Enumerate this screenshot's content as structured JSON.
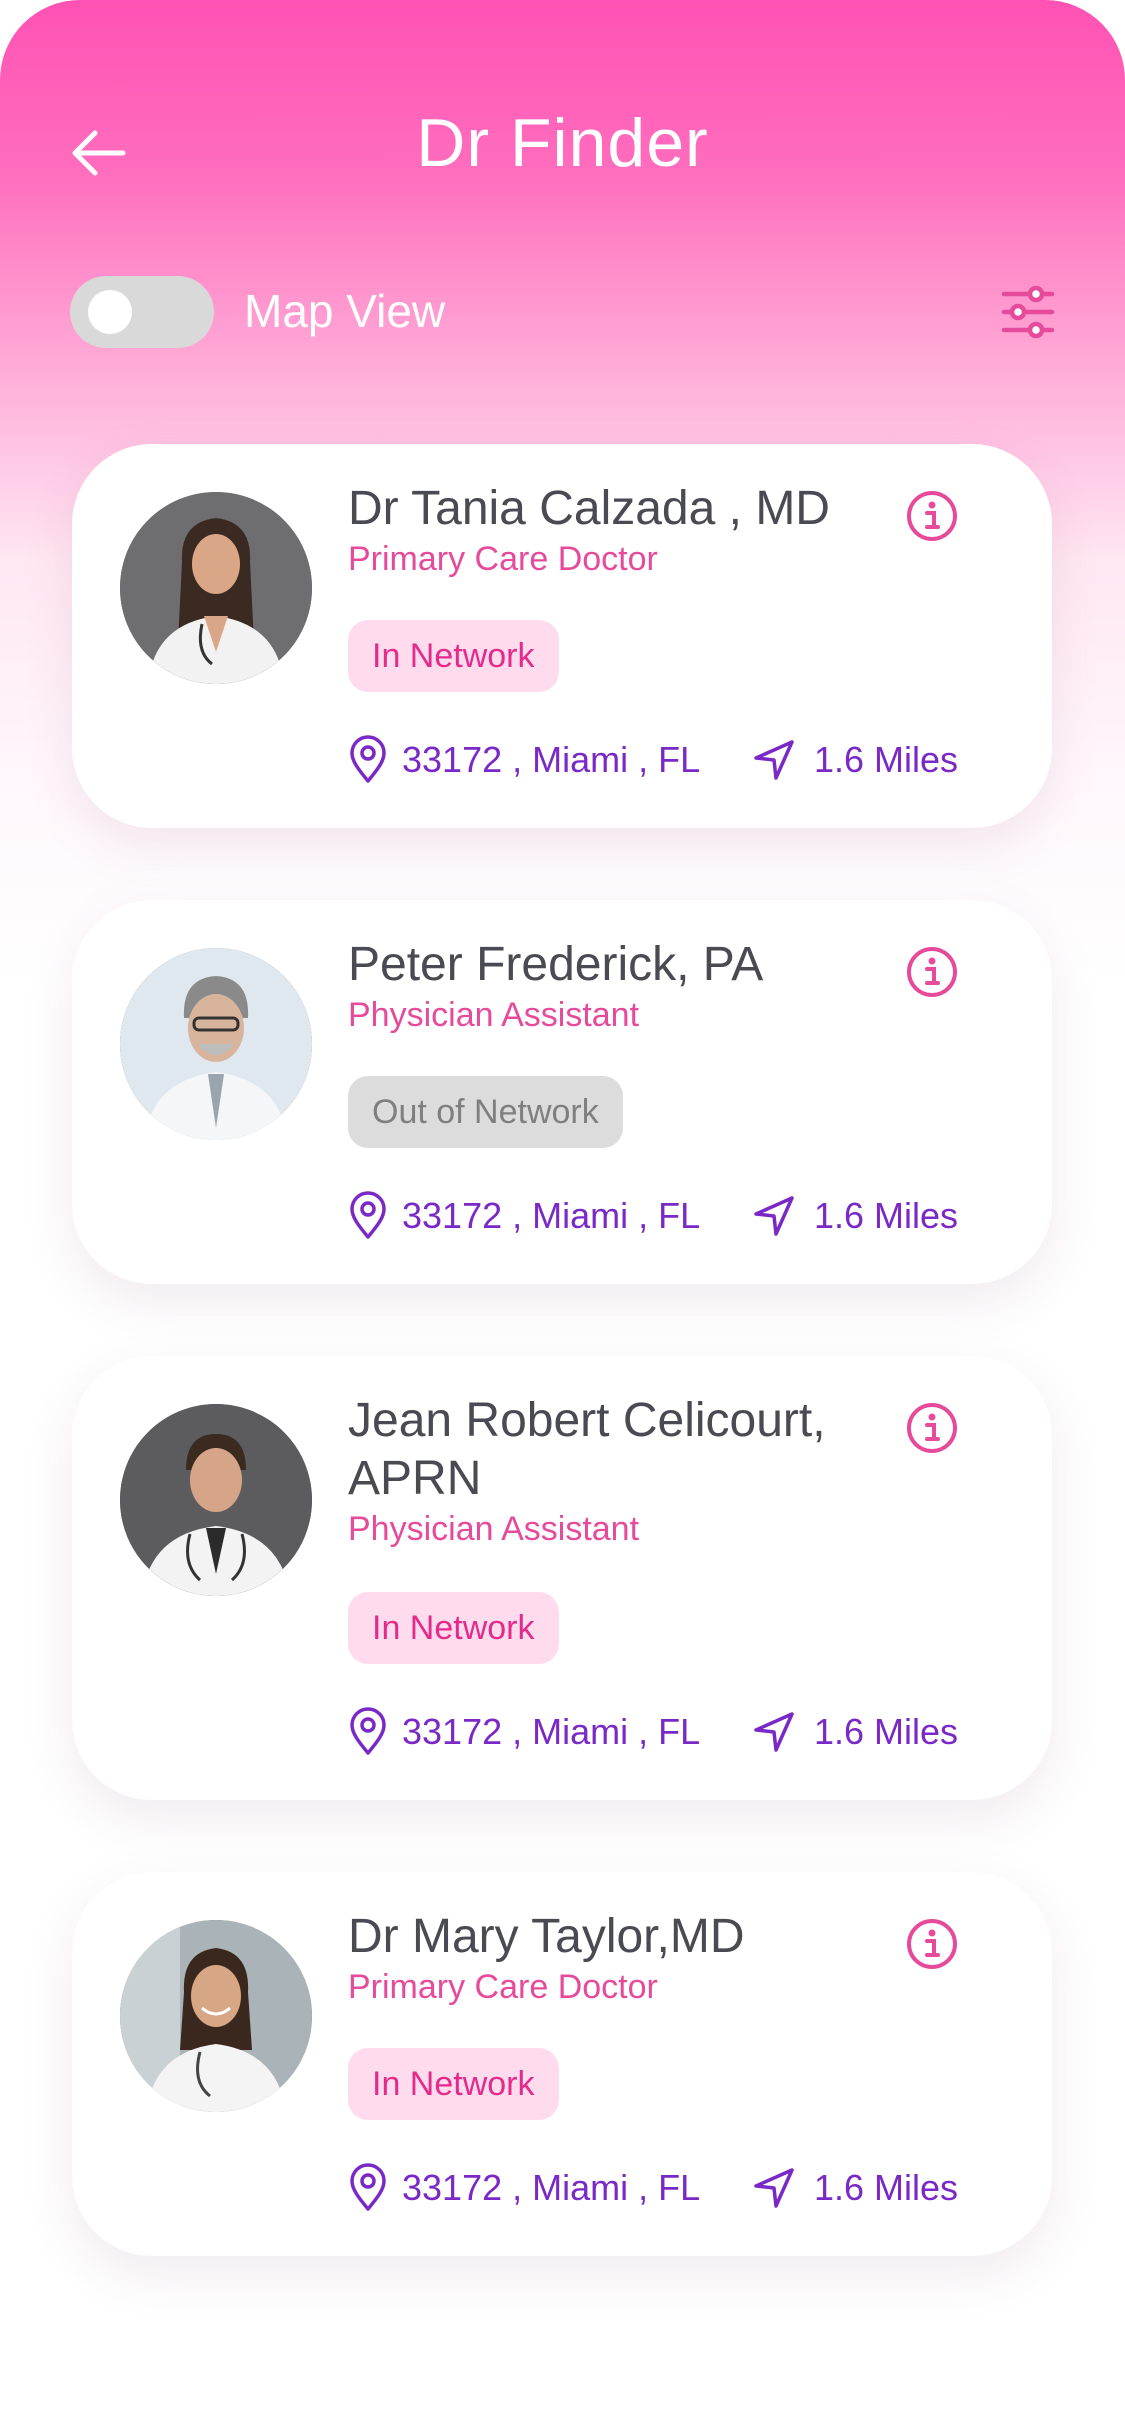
{
  "header": {
    "title": "Dr Finder",
    "map_view_label": "Map View",
    "map_view_enabled": false
  },
  "doctors": [
    {
      "name": "Dr Tania Calzada , MD",
      "specialty": "Primary Care Doctor",
      "network": "In Network",
      "location": "33172 , Miami , FL",
      "distance": "1.6 Miles"
    },
    {
      "name": "Peter Frederick, PA",
      "specialty": "Physician Assistant",
      "network": "Out of Network",
      "location": "33172 , Miami , FL",
      "distance": "1.6 Miles"
    },
    {
      "name": "Jean Robert Celicourt, APRN",
      "specialty": "Physician Assistant",
      "network": "In Network",
      "location": "33172 , Miami , FL",
      "distance": "1.6 Miles"
    },
    {
      "name": "Dr Mary Taylor,MD",
      "specialty": "Primary Care Doctor",
      "network": "In Network",
      "location": "33172 , Miami , FL",
      "distance": "1.6 Miles"
    }
  ],
  "icons": {
    "back": "arrow-left-icon",
    "filter": "sliders-icon",
    "info": "info-icon",
    "location": "map-pin-icon",
    "distance": "navigation-arrow-icon"
  },
  "colors": {
    "accent_pink": "#e64b9b",
    "accent_purple": "#7a28c6",
    "in_network_bg": "#ffdced",
    "out_network_bg": "#dcdcdc"
  }
}
